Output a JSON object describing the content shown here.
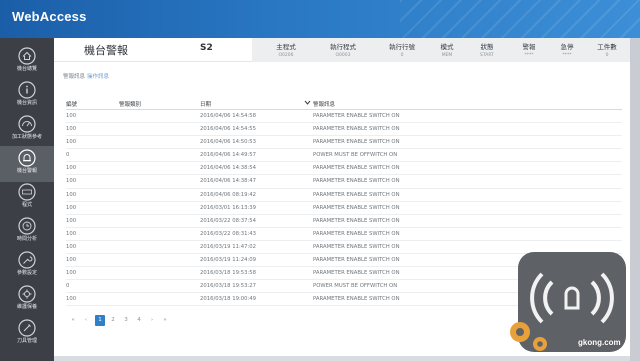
{
  "app": {
    "logo": "WebAccess"
  },
  "sidebar": {
    "items": [
      {
        "icon": "home-icon",
        "label": "機台總覽"
      },
      {
        "icon": "info-icon",
        "label": "機台資訊"
      },
      {
        "icon": "gauge-icon",
        "label": "加工狀態參考"
      },
      {
        "icon": "alarm-icon",
        "label": "機台警報"
      },
      {
        "icon": "ncp-icon",
        "label": "程式"
      },
      {
        "icon": "clock-icon",
        "label": "時間分析"
      },
      {
        "icon": "wrench-icon",
        "label": "參數設定"
      },
      {
        "icon": "tool-icon",
        "label": "維護保養"
      },
      {
        "icon": "knife-icon",
        "label": "刀具管理"
      }
    ],
    "active_index": 3
  },
  "header": {
    "title": "機台警報",
    "machine": "S2",
    "status": [
      {
        "label": "主程式",
        "value": "O0206"
      },
      {
        "label": "執行程式",
        "value": "O0003"
      },
      {
        "label": "執行行號",
        "value": "0"
      },
      {
        "label": "模式",
        "value": "MEM"
      },
      {
        "label": "狀態",
        "value": "START"
      },
      {
        "label": "警報",
        "value": "****"
      },
      {
        "label": "急停",
        "value": "****"
      },
      {
        "label": "工件數",
        "value": "0"
      }
    ]
  },
  "tabs": [
    "警報訊息",
    "操作訊息"
  ],
  "table": {
    "columns": [
      "編號",
      "警報類別",
      "日期",
      "警報訊息"
    ],
    "rows": [
      [
        "100",
        "",
        "2016/04/06 14:54:58",
        "PARAMETER ENABLE SWITCH ON"
      ],
      [
        "100",
        "",
        "2016/04/06 14:54:55",
        "PARAMETER ENABLE SWITCH ON"
      ],
      [
        "100",
        "",
        "2016/04/06 14:50:53",
        "PARAMETER ENABLE SWITCH ON"
      ],
      [
        "0",
        "",
        "2016/04/06 14:49:57",
        "POWER MUST BE OFFWITCH ON"
      ],
      [
        "100",
        "",
        "2016/04/06 14:38:54",
        "PARAMETER ENABLE SWITCH ON"
      ],
      [
        "100",
        "",
        "2016/04/06 14:38:47",
        "PARAMETER ENABLE SWITCH ON"
      ],
      [
        "100",
        "",
        "2016/04/06 08:19:42",
        "PARAMETER ENABLE SWITCH ON"
      ],
      [
        "100",
        "",
        "2016/03/01 16:13:39",
        "PARAMETER ENABLE SWITCH ON"
      ],
      [
        "100",
        "",
        "2016/03/22 08:37:54",
        "PARAMETER ENABLE SWITCH ON"
      ],
      [
        "100",
        "",
        "2016/03/22 08:31:43",
        "PARAMETER ENABLE SWITCH ON"
      ],
      [
        "100",
        "",
        "2016/03/19 11:47:02",
        "PARAMETER ENABLE SWITCH ON"
      ],
      [
        "100",
        "",
        "2016/03/19 11:24:09",
        "PARAMETER ENABLE SWITCH ON"
      ],
      [
        "100",
        "",
        "2016/03/18 19:53:58",
        "PARAMETER ENABLE SWITCH ON"
      ],
      [
        "0",
        "",
        "2016/03/18 19:53:27",
        "POWER MUST BE OFFWITCH ON"
      ],
      [
        "100",
        "",
        "2016/03/18 19:00:49",
        "PARAMETER ENABLE SWITCH ON"
      ]
    ]
  },
  "pager": {
    "first": "«",
    "prev": "‹",
    "pages": [
      "1",
      "2",
      "3",
      "4"
    ],
    "next": "›",
    "last": "»",
    "current": "1"
  },
  "watermark": {
    "text": "gkong.com"
  },
  "colors": {
    "topbar": "#2a78c4",
    "sidebar": "#3c4046",
    "accent": "#2f7fc9"
  }
}
